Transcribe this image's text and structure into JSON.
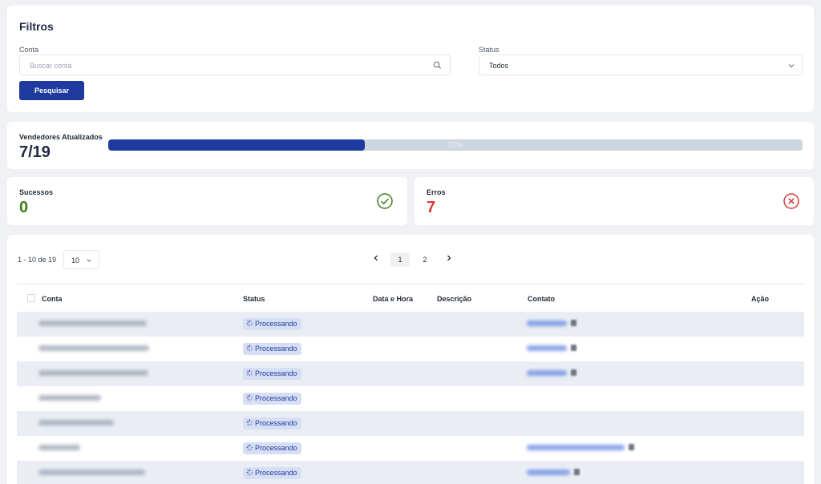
{
  "filters": {
    "title": "Filtros",
    "account_label": "Conta",
    "account_placeholder": "Buscar conta",
    "status_label": "Status",
    "status_value": "Todos",
    "search_button": "Pesquisar"
  },
  "progress": {
    "label": "Vendedores Atualizados",
    "value": "7/19",
    "percent_text": "37%",
    "percent": 37
  },
  "stats": {
    "success_label": "Sucessos",
    "success_value": "0",
    "success_color": "#3f7d1e",
    "errors_label": "Erros",
    "errors_value": "7",
    "errors_color": "#d93a3a"
  },
  "table": {
    "range_text": "1 - 10 de 19",
    "page_size": "10",
    "pages": [
      "1",
      "2"
    ],
    "current_page": "1",
    "headers": {
      "account": "Conta",
      "status": "Status",
      "datetime": "Data e Hora",
      "description": "Descrição",
      "contact": "Contato",
      "action": "Ação"
    },
    "rows": [
      {
        "status": "Processando",
        "has_contact": true
      },
      {
        "status": "Processando",
        "has_contact": true
      },
      {
        "status": "Processando",
        "has_contact": true
      },
      {
        "status": "Processando",
        "has_contact": false
      },
      {
        "status": "Processando",
        "has_contact": false
      },
      {
        "status": "Processando",
        "has_contact": true
      },
      {
        "status": "Processando",
        "has_contact": true
      }
    ]
  },
  "icons": {
    "search": "search-icon",
    "chevron": "chevron-down-icon",
    "success": "check-circle-icon",
    "error": "x-circle-icon",
    "spinner": "spinner-icon",
    "copy": "copy-icon"
  },
  "colors": {
    "primary": "#1e3a9e",
    "badge_bg": "#d7dff5"
  }
}
